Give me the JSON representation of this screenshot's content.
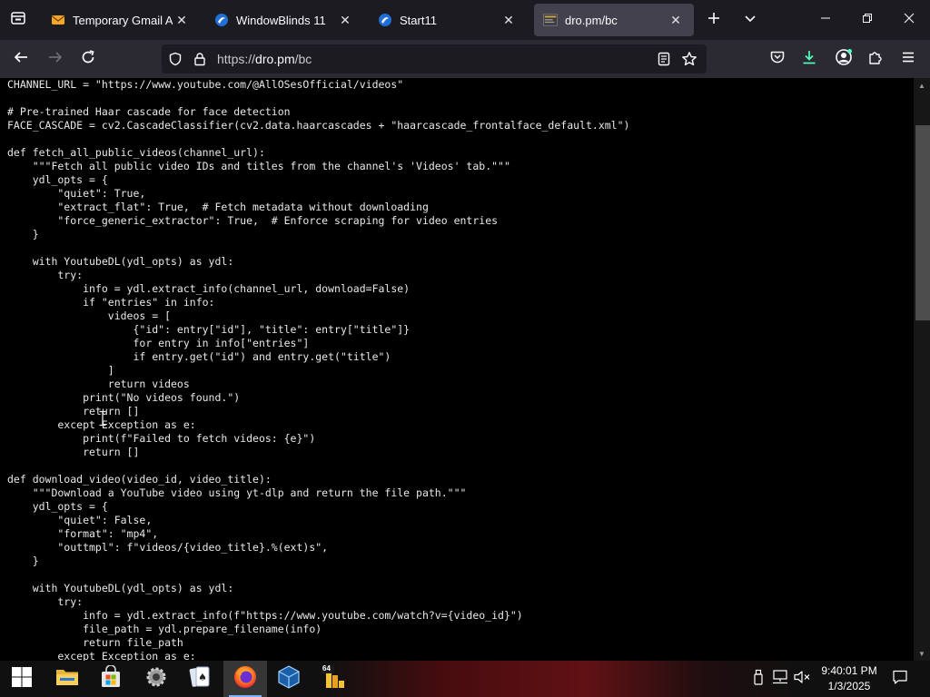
{
  "browser": {
    "tabs": [
      {
        "title": "Temporary Gmail Acco",
        "favicon": "mail-icon",
        "active": false
      },
      {
        "title": "WindowBlinds 11",
        "favicon": "stardock-icon",
        "active": false
      },
      {
        "title": "Start11",
        "favicon": "stardock-icon",
        "active": false
      },
      {
        "title": "dro.pm/bc",
        "favicon": "page-thumbnail-icon",
        "active": true
      }
    ],
    "url": {
      "scheme": "https://",
      "host": "dro.pm",
      "path": "/bc"
    },
    "colors": {
      "tab_strip": "#1c1b22",
      "toolbar": "#2b2a33",
      "active_tab": "#42414d",
      "download_accent": "#54ffbd"
    }
  },
  "code_lines": [
    "CHANNEL_URL = \"https://www.youtube.com/@AllOSesOfficial/videos\"",
    "",
    "# Pre-trained Haar cascade for face detection",
    "FACE_CASCADE = cv2.CascadeClassifier(cv2.data.haarcascades + \"haarcascade_frontalface_default.xml\")",
    "",
    "def fetch_all_public_videos(channel_url):",
    "    \"\"\"Fetch all public video IDs and titles from the channel's 'Videos' tab.\"\"\"",
    "    ydl_opts = {",
    "        \"quiet\": True,",
    "        \"extract_flat\": True,  # Fetch metadata without downloading",
    "        \"force_generic_extractor\": True,  # Enforce scraping for video entries",
    "    }",
    "",
    "    with YoutubeDL(ydl_opts) as ydl:",
    "        try:",
    "            info = ydl.extract_info(channel_url, download=False)",
    "            if \"entries\" in info:",
    "                videos = [",
    "                    {\"id\": entry[\"id\"], \"title\": entry[\"title\"]}",
    "                    for entry in info[\"entries\"]",
    "                    if entry.get(\"id\") and entry.get(\"title\")",
    "                ]",
    "                return videos",
    "            print(\"No videos found.\")",
    "            return []",
    "        except Exception as e:",
    "            print(f\"Failed to fetch videos: {e}\")",
    "            return []",
    "",
    "def download_video(video_id, video_title):",
    "    \"\"\"Download a YouTube video using yt-dlp and return the file path.\"\"\"",
    "    ydl_opts = {",
    "        \"quiet\": False,",
    "        \"format\": \"mp4\",",
    "        \"outtmpl\": f\"videos/{video_title}.%(ext)s\",",
    "    }",
    "",
    "    with YoutubeDL(ydl_opts) as ydl:",
    "        try:",
    "            info = ydl.extract_info(f\"https://www.youtube.com/watch?v={video_id}\")",
    "            file_path = ydl.prepare_filename(info)",
    "            return file_path",
    "        except Exception as e:"
  ],
  "taskbar": {
    "apps": [
      {
        "name": "start-button-icon",
        "active": false
      },
      {
        "name": "file-explorer-icon",
        "active": false
      },
      {
        "name": "microsoft-store-icon",
        "active": false
      },
      {
        "name": "settings-gear-icon",
        "active": false
      },
      {
        "name": "solitaire-cards-icon",
        "active": false
      },
      {
        "name": "firefox-icon",
        "active": true
      },
      {
        "name": "virtualbox-icon",
        "active": false
      },
      {
        "name": "app-64-icon",
        "active": false
      }
    ],
    "app64_badge": "64",
    "clock": {
      "time": "9:40:01 PM",
      "date": "1/3/2025"
    }
  }
}
